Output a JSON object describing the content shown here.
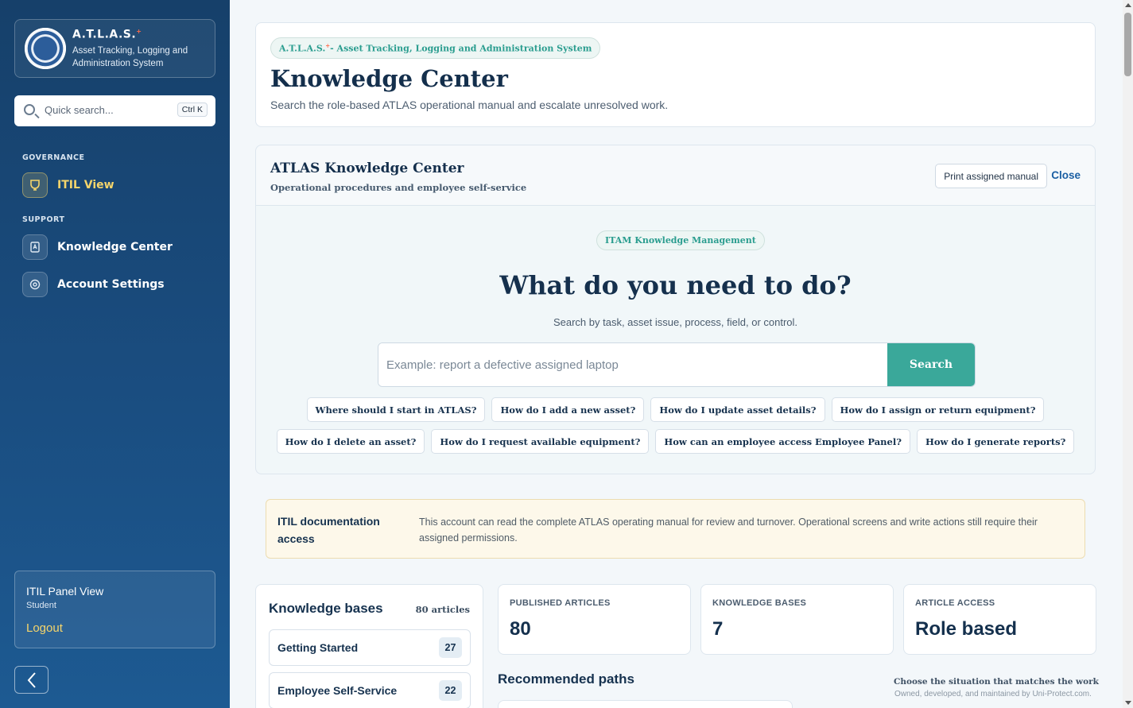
{
  "sidebar": {
    "brand_title": "A.T.L.A.S.",
    "brand_mark": "+",
    "brand_subtitle": "Asset Tracking, Logging and Administration System",
    "search_placeholder": "Quick search...",
    "search_shortcut": "Ctrl K",
    "groups": [
      {
        "label": "GOVERNANCE",
        "items": [
          {
            "label": "ITIL View",
            "icon": "itil-icon",
            "active": true
          }
        ]
      },
      {
        "label": "SUPPORT",
        "items": [
          {
            "label": "Knowledge Center",
            "icon": "book-icon",
            "active": false
          },
          {
            "label": "Account Settings",
            "icon": "settings-icon",
            "active": false
          }
        ]
      }
    ],
    "user": {
      "panel": "ITIL Panel View",
      "role": "Student",
      "logout": "Logout"
    },
    "collapse_icon": "chevron-left-icon"
  },
  "hero": {
    "pill_brand": "A.T.L.A.S.",
    "pill_mark": "+",
    "pill_text": "- Asset Tracking, Logging and Administration System",
    "title": "Knowledge Center",
    "description": "Search the role-based ATLAS operational manual and escalate unresolved work."
  },
  "kc": {
    "title": "ATLAS Knowledge Center",
    "subtitle": "Operational procedures and employee self-service",
    "print_label": "Print assigned manual",
    "close_label": "Close",
    "pill": "ITAM Knowledge Management",
    "question": "What do you need to do?",
    "hint": "Search by task, asset issue, process, field, or control.",
    "search_placeholder": "Example: report a defective assigned laptop",
    "search_button": "Search",
    "chips_row1": [
      "Where should I start in ATLAS?",
      "How do I add a new asset?",
      "How do I update asset details?",
      "How do I assign or return equipment?"
    ],
    "chips_row2": [
      "How do I delete an asset?",
      "How do I request available equipment?",
      "How can an employee access Employee Panel?",
      "How do I generate reports?"
    ]
  },
  "notice": {
    "title": "ITIL documentation access",
    "text": "This account can read the complete ATLAS operating manual for review and turnover. Operational screens and write actions still require their assigned permissions."
  },
  "kb": {
    "title": "Knowledge bases",
    "count": "80 articles",
    "items": [
      {
        "label": "Getting Started",
        "count": "27"
      },
      {
        "label": "Employee Self-Service",
        "count": "22"
      }
    ]
  },
  "stats": [
    {
      "label": "PUBLISHED ARTICLES",
      "value": "80"
    },
    {
      "label": "KNOWLEDGE BASES",
      "value": "7"
    },
    {
      "label": "ARTICLE ACCESS",
      "value": "Role based"
    }
  ],
  "recommended": {
    "title": "Recommended paths",
    "hint": "Choose the situation that matches the work",
    "owned": "Owned, developed, and maintained by Uni-Protect.com."
  },
  "colors": {
    "accent": "#3aa89a",
    "sidebar": "#1a4d80",
    "highlight": "#f5d56b"
  }
}
